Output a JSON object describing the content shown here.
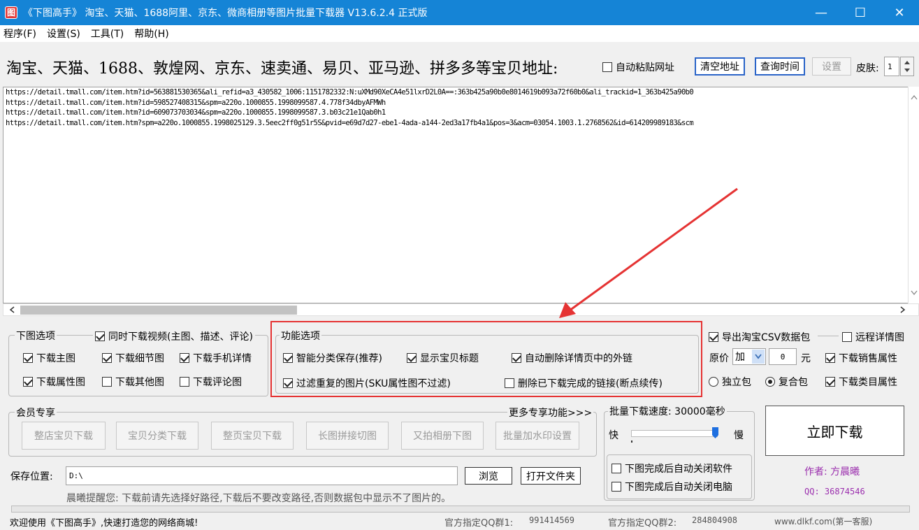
{
  "window": {
    "title": "《下图高手》 淘宝、天猫、1688阿里、京东、微商相册等图片批量下载器 V13.6.2.4 正式版",
    "icon_glyph": "图",
    "minimize_glyph": "—",
    "maximize_glyph": "☐",
    "close_glyph": "✕"
  },
  "menu": [
    "程序(F)",
    "设置(S)",
    "工具(T)",
    "帮助(H)"
  ],
  "url_header": {
    "label": "淘宝、天猫、1688、敦煌网、京东、速卖通、易贝、亚马逊、拼多多等宝贝地址:",
    "auto_paste": {
      "label": "自动粘贴网址",
      "checked": false
    },
    "clear_button": "清空地址",
    "query_button": "查询时间",
    "settings_button": "设置",
    "skin_label": "皮肤:",
    "skin_value": "1"
  },
  "urls": [
    "https://detail.tmall.com/item.htm?id=563881530365&ali_refid=a3_430582_1006:1151782332:N:uXMd90XeCA4e51lxrD2L0A==:363b425a90b0e8014619b093a72f60b0&ali_trackid=1_363b425a90b0",
    "https://detail.tmall.com/item.htm?id=598527408315&spm=a220o.1000855.1998099587.4.778f34dbyAFMWh",
    "https://detail.tmall.com/item.htm?id=609073703034&spm=a220o.1000855.1998099587.3.b03c21e1Qab0h1",
    "https://detail.tmall.com/item.htm?spm=a220o.1000855.1998025129.3.5eec2ff0g51r5S&pvid=e69d7d27-ebe1-4ada-a144-2ed3a17fb4a1&pos=3&acm=03054.1003.1.2768562&id=614209989183&scm"
  ],
  "download_options": {
    "legend": "下图选项",
    "video": {
      "label": "同时下载视频(主图、描述、评论)",
      "checked": true
    },
    "main_image": {
      "label": "下载主图",
      "checked": true
    },
    "detail_image": {
      "label": "下载细节图",
      "checked": true
    },
    "mobile_detail": {
      "label": "下载手机详情",
      "checked": true
    },
    "attr_image": {
      "label": "下载属性图",
      "checked": true
    },
    "other_image": {
      "label": "下载其他图",
      "checked": false
    },
    "review_image": {
      "label": "下载评论图",
      "checked": false
    }
  },
  "function_options": {
    "legend": "功能选项",
    "smart_save": {
      "label": "智能分类保存(推荐)",
      "checked": true
    },
    "show_title": {
      "label": "显示宝贝标题",
      "checked": true
    },
    "auto_remove_links": {
      "label": "自动删除详情页中的外链",
      "checked": true
    },
    "filter_dup": {
      "label": "过滤重复的图片(SKU属性图不过滤)",
      "checked": true
    },
    "delete_done": {
      "label": "删除已下载完成的链接(断点续传)",
      "checked": false
    }
  },
  "csv_options": {
    "export_csv": {
      "label": "导出淘宝CSV数据包",
      "checked": true
    },
    "remote_detail": {
      "label": "远程详情图",
      "checked": false
    },
    "price_label": "原价",
    "price_op": "加",
    "price_value": "0",
    "price_unit": "元",
    "sales_attr": {
      "label": "下载销售属性",
      "checked": true
    },
    "standalone": {
      "label": "独立包",
      "checked": false
    },
    "combined": {
      "label": "复合包",
      "checked": true
    },
    "category_attr": {
      "label": "下载类目属性",
      "checked": true
    }
  },
  "member": {
    "legend": "会员专享",
    "more": "更多专享功能>>>",
    "buttons": [
      "整店宝贝下载",
      "宝贝分类下载",
      "整页宝贝下载",
      "长图拼接切图",
      "又拍相册下图",
      "批量加水印设置"
    ]
  },
  "speed": {
    "legend": "批量下载速度: 30000毫秒",
    "fast": "快",
    "slow": "慢",
    "level": 0.95,
    "close_app": {
      "label": "下图完成后自动关闭软件",
      "checked": false
    },
    "shutdown": {
      "label": "下图完成后自动关闭电脑",
      "checked": false
    }
  },
  "start_button": "立即下载",
  "author": "作者: 方晨曦",
  "qq": "QQ: 36874546",
  "save": {
    "label": "保存位置:",
    "path": "D:\\",
    "browse": "浏览",
    "open_folder": "打开文件夹",
    "hint": "晨曦提醒您: 下载前请先选择好路径,下载后不要改变路径,否则数据包中显示不了图片的。"
  },
  "status": {
    "welcome": "欢迎使用《下图高手》,快速打造您的网络商城!",
    "qq_group1_label": "官方指定QQ群1:",
    "qq_group1": "991414569",
    "qq_group2_label": "官方指定QQ群2:",
    "qq_group2": "284804908",
    "site": "www.dlkf.com(第一客服)"
  },
  "colors": {
    "titlebar": "#1584d6",
    "highlight": "#e53333",
    "author": "#9b2fae",
    "accent": "#2a64c8"
  }
}
